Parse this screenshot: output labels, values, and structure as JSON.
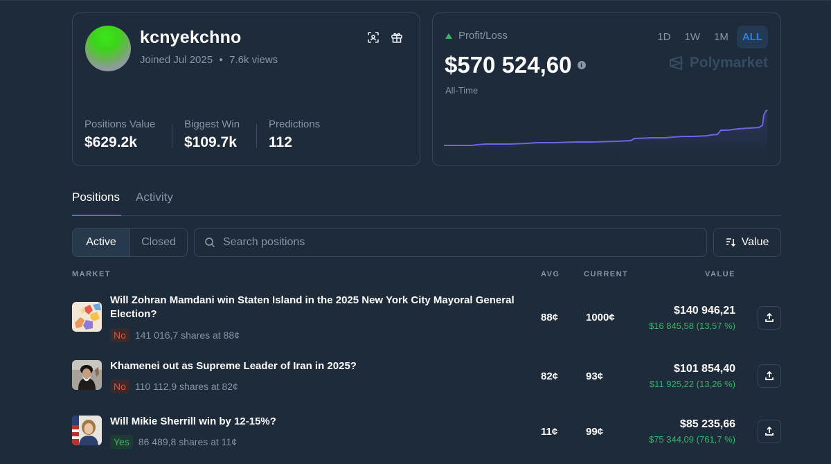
{
  "profile": {
    "username": "kcnyekchno",
    "joined": "Joined Jul 2025",
    "views": "7.6k views",
    "stats": [
      {
        "label": "Positions Value",
        "value": "$629.2k"
      },
      {
        "label": "Biggest Win",
        "value": "$109.7k"
      },
      {
        "label": "Predictions",
        "value": "112"
      }
    ]
  },
  "pnl": {
    "title": "Profit/Loss",
    "amount": "$570 524,60",
    "period_label": "All-Time",
    "ranges": [
      "1D",
      "1W",
      "1M",
      "ALL"
    ],
    "selected_range": "ALL",
    "brand": "Polymarket",
    "accent_color": "#2e7fe0",
    "line_color": "#6f63e6",
    "up_color": "#3db468"
  },
  "tabs": {
    "positions": "Positions",
    "activity": "Activity"
  },
  "filters": {
    "active": "Active",
    "closed": "Closed",
    "search_placeholder": "Search positions",
    "sort_label": "Value"
  },
  "table": {
    "headers": {
      "market": "MARKET",
      "avg": "AVG",
      "current": "CURRENT",
      "value": "VALUE"
    },
    "rows": [
      {
        "question": "Will Zohran Mamdani win Staten Island in the 2025 New York City Mayoral General Election?",
        "outcome": "No",
        "shares": "141 016,7 shares at 88¢",
        "avg": "88¢",
        "current": "1000¢",
        "value": "$140 946,21",
        "change": "$16 845,58 (13,57 %)"
      },
      {
        "question": "Khamenei out as Supreme Leader of Iran in 2025?",
        "outcome": "No",
        "shares": "110 112,9 shares at 82¢",
        "avg": "82¢",
        "current": "93¢",
        "value": "$101 854,40",
        "change": "$11 925,22 (13,26 %)"
      },
      {
        "question": "Will Mikie Sherrill win by 12-15%?",
        "outcome": "Yes",
        "shares": "86 489,8 shares at 11¢",
        "avg": "11¢",
        "current": "99¢",
        "value": "$85 235,66",
        "change": "$75 344,09 (761,7 %)"
      }
    ]
  }
}
